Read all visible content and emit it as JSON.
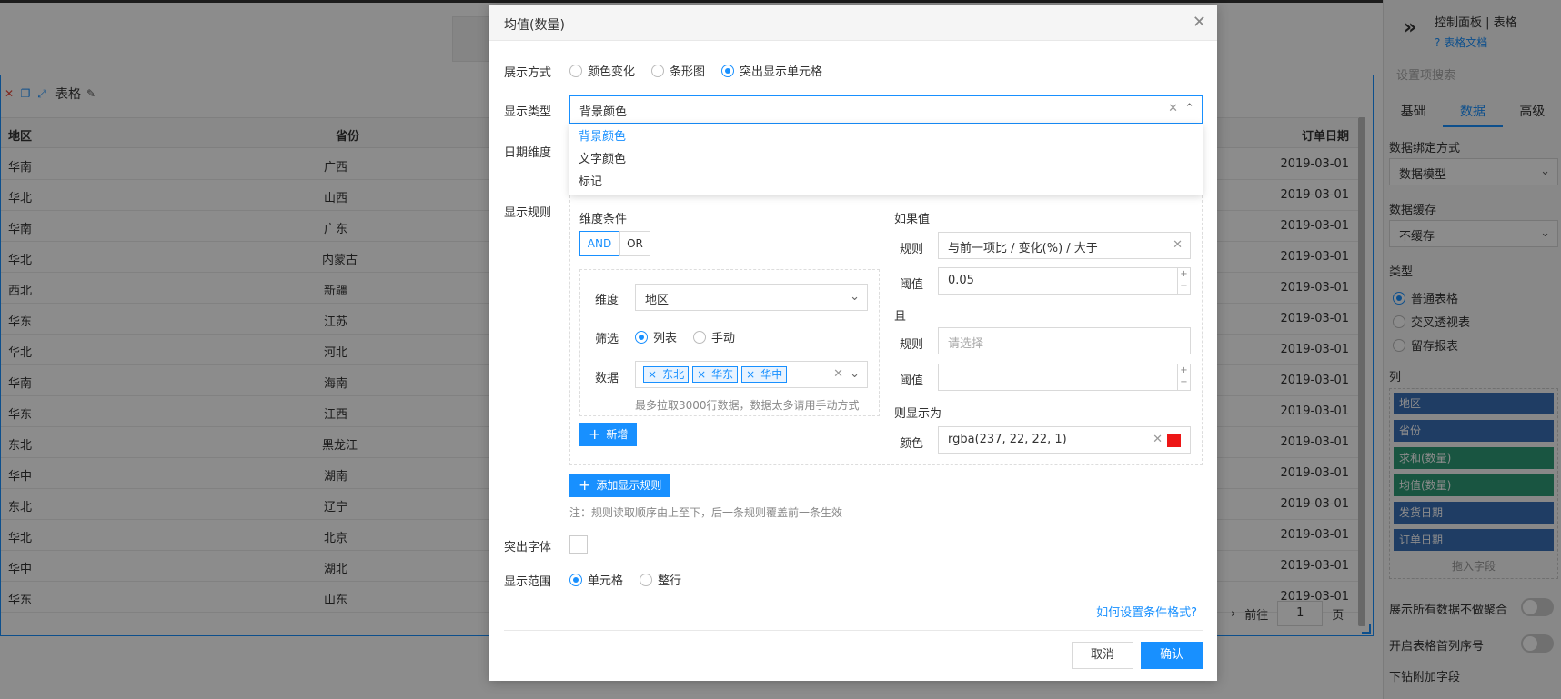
{
  "table": {
    "title": "表格",
    "columns": {
      "region": "地区",
      "province": "省份",
      "order_date": "订单日期"
    },
    "rows": [
      {
        "region": "华南",
        "province": "广西",
        "date": "2019-03-01"
      },
      {
        "region": "华北",
        "province": "山西",
        "date": "2019-03-01"
      },
      {
        "region": "华南",
        "province": "广东",
        "date": "2019-03-01"
      },
      {
        "region": "华北",
        "province": "内蒙古",
        "date": "2019-03-01"
      },
      {
        "region": "西北",
        "province": "新疆",
        "date": "2019-03-01"
      },
      {
        "region": "华东",
        "province": "江苏",
        "date": "2019-03-01"
      },
      {
        "region": "华北",
        "province": "河北",
        "date": "2019-03-01"
      },
      {
        "region": "华南",
        "province": "海南",
        "date": "2019-03-01"
      },
      {
        "region": "华东",
        "province": "江西",
        "date": "2019-03-01"
      },
      {
        "region": "东北",
        "province": "黑龙江",
        "date": "2019-03-01"
      },
      {
        "region": "华中",
        "province": "湖南",
        "date": "2019-03-01"
      },
      {
        "region": "东北",
        "province": "辽宁",
        "date": "2019-03-01"
      },
      {
        "region": "华北",
        "province": "北京",
        "date": "2019-03-01"
      },
      {
        "region": "华中",
        "province": "湖北",
        "date": "2019-03-01"
      },
      {
        "region": "华东",
        "province": "山东",
        "date": "2019-03-01"
      }
    ],
    "pager": {
      "prefix": "前往",
      "page": "1",
      "suffix": "页"
    }
  },
  "side": {
    "breadcrumb": "控制面板 | 表格",
    "doc_link": "表格文档",
    "search_placeholder": "设置项搜索",
    "tabs": [
      "基础",
      "数据",
      "高级"
    ],
    "binding_label": "数据绑定方式",
    "binding_value": "数据模型",
    "cache_label": "数据缓存",
    "cache_value": "不缓存",
    "type_label": "类型",
    "types": [
      "普通表格",
      "交叉透视表",
      "留存报表"
    ],
    "columns_label": "列",
    "columns": [
      {
        "name": "地区",
        "color": "blue"
      },
      {
        "name": "省份",
        "color": "blue"
      },
      {
        "name": "求和(数量)",
        "color": "green"
      },
      {
        "name": "均值(数量)",
        "color": "green"
      },
      {
        "name": "发货日期",
        "color": "blue"
      },
      {
        "name": "订单日期",
        "color": "blue"
      }
    ],
    "drop_hint": "拖入字段",
    "toggle_all": "展示所有数据不做聚合",
    "toggle_seq": "开启表格首列序号",
    "drill_label": "下钻附加字段"
  },
  "modal": {
    "title": "均值(数量)",
    "display_mode_label": "展示方式",
    "display_modes": [
      "颜色变化",
      "条形图",
      "突出显示单元格"
    ],
    "display_type_label": "显示类型",
    "display_type_value": "背景颜色",
    "display_type_options": [
      "背景颜色",
      "文字颜色",
      "标记"
    ],
    "date_dim_label": "日期维度",
    "rules_label": "显示规则",
    "dim_cond_label": "维度条件",
    "and_label": "AND",
    "or_label": "OR",
    "dim_label": "维度",
    "dim_value": "地区",
    "filter_label": "筛选",
    "filter_options": [
      "列表",
      "手动"
    ],
    "data_label": "数据",
    "data_tags": [
      "东北",
      "华东",
      "华中"
    ],
    "data_hint": "最多拉取3000行数据，数据太多请用手动方式",
    "add_btn": "新增",
    "if_value_label": "如果值",
    "rule_label": "规则",
    "rule1_value": "与前一项比 / 变化(%) / 大于",
    "threshold_label": "阈值",
    "threshold1_value": "0.05",
    "and_cn_label": "且",
    "rule2_placeholder": "请选择",
    "threshold2_value": "",
    "then_show_label": "则显示为",
    "color_label": "颜色",
    "color_value": "rgba(237, 22, 22, 1)",
    "color_swatch": "#ed1616",
    "add_rule_btn": "添加显示规则",
    "note": "注：规则读取顺序由上至下，后一条规则覆盖前一条生效",
    "highlight_font_label": "突出字体",
    "scope_label": "显示范围",
    "scope_options": [
      "单元格",
      "整行"
    ],
    "help_link": "如何设置条件格式?",
    "cancel": "取消",
    "confirm": "确认"
  },
  "colors": {
    "accent": "#1890ff"
  }
}
